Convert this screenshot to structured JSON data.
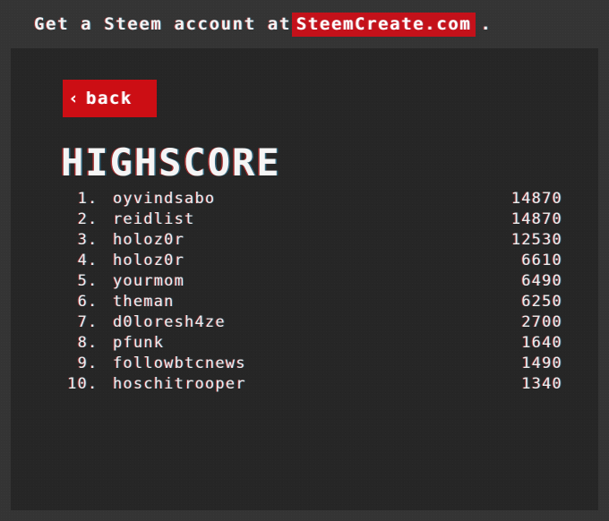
{
  "banner": {
    "prefix": "Get a Steem account at",
    "link_text": "SteemCreate.com",
    "suffix": ".",
    "link_bg_color": "#c4111a"
  },
  "back_button": {
    "chevron": "‹",
    "label": "back",
    "bg_color": "#cc0e14"
  },
  "page_title": "HIGHSCORE",
  "highscore": {
    "columns": [
      "rank",
      "name",
      "score"
    ],
    "rows": [
      {
        "rank": "1",
        "dot": ".",
        "name": "oyvindsabo",
        "score": "14870"
      },
      {
        "rank": "2",
        "dot": ".",
        "name": "reidlist",
        "score": "14870"
      },
      {
        "rank": "3",
        "dot": ".",
        "name": "holoz0r",
        "score": "12530"
      },
      {
        "rank": "4",
        "dot": ".",
        "name": "holoz0r",
        "score": "6610"
      },
      {
        "rank": "5",
        "dot": ".",
        "name": "yourmom",
        "score": "6490"
      },
      {
        "rank": "6",
        "dot": ".",
        "name": "theman",
        "score": "6250"
      },
      {
        "rank": "7",
        "dot": ".",
        "name": "d0loresh4ze",
        "score": "2700"
      },
      {
        "rank": "8",
        "dot": ".",
        "name": "pfunk",
        "score": "1640"
      },
      {
        "rank": "9",
        "dot": ".",
        "name": "followbtcnews",
        "score": "1490"
      },
      {
        "rank": "10",
        "dot": ".",
        "name": "hoschitrooper",
        "score": "1340"
      }
    ]
  },
  "theme": {
    "outer_bg": "#343434",
    "panel_bg": "#262626",
    "text_color": "#ededed",
    "accent_red": "#cc0e14"
  }
}
